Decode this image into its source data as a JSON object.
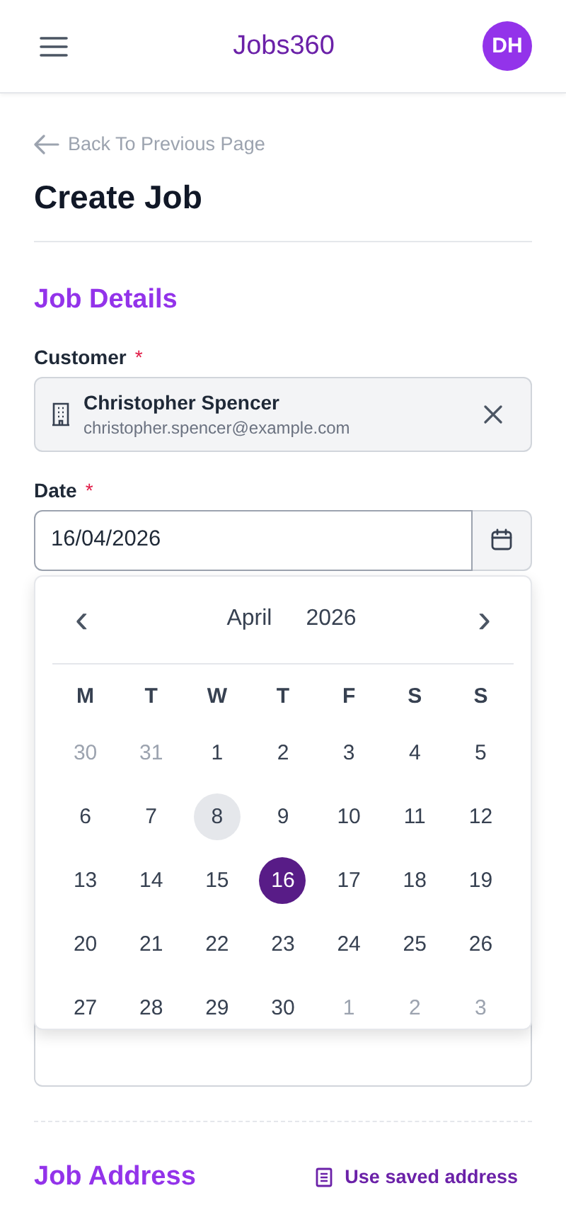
{
  "header": {
    "brand": "Jobs360",
    "avatar": "DH"
  },
  "back_link": "Back To Previous Page",
  "page_title": "Create Job",
  "job_details": {
    "heading": "Job Details",
    "customer": {
      "label": "Customer",
      "required": "*",
      "name": "Christopher Spencer",
      "email": "christopher.spencer@example.com"
    },
    "date": {
      "label": "Date",
      "required": "*",
      "value": "16/04/2026"
    }
  },
  "calendar": {
    "prev": "‹",
    "next": "›",
    "month": "April",
    "year": "2026",
    "weekdays": [
      "M",
      "T",
      "W",
      "T",
      "F",
      "S",
      "S"
    ],
    "weeks": [
      [
        {
          "day": "30",
          "outside": true,
          "selected": false,
          "today": false
        },
        {
          "day": "31",
          "outside": true,
          "selected": false,
          "today": false
        },
        {
          "day": "1",
          "outside": false,
          "selected": false,
          "today": false
        },
        {
          "day": "2",
          "outside": false,
          "selected": false,
          "today": false
        },
        {
          "day": "3",
          "outside": false,
          "selected": false,
          "today": false
        },
        {
          "day": "4",
          "outside": false,
          "selected": false,
          "today": false
        },
        {
          "day": "5",
          "outside": false,
          "selected": false,
          "today": false
        }
      ],
      [
        {
          "day": "6",
          "outside": false,
          "selected": false,
          "today": false
        },
        {
          "day": "7",
          "outside": false,
          "selected": false,
          "today": false
        },
        {
          "day": "8",
          "outside": false,
          "selected": false,
          "today": true
        },
        {
          "day": "9",
          "outside": false,
          "selected": false,
          "today": false
        },
        {
          "day": "10",
          "outside": false,
          "selected": false,
          "today": false
        },
        {
          "day": "11",
          "outside": false,
          "selected": false,
          "today": false
        },
        {
          "day": "12",
          "outside": false,
          "selected": false,
          "today": false
        }
      ],
      [
        {
          "day": "13",
          "outside": false,
          "selected": false,
          "today": false
        },
        {
          "day": "14",
          "outside": false,
          "selected": false,
          "today": false
        },
        {
          "day": "15",
          "outside": false,
          "selected": false,
          "today": false
        },
        {
          "day": "16",
          "outside": false,
          "selected": true,
          "today": false
        },
        {
          "day": "17",
          "outside": false,
          "selected": false,
          "today": false
        },
        {
          "day": "18",
          "outside": false,
          "selected": false,
          "today": false
        },
        {
          "day": "19",
          "outside": false,
          "selected": false,
          "today": false
        }
      ],
      [
        {
          "day": "20",
          "outside": false,
          "selected": false,
          "today": false
        },
        {
          "day": "21",
          "outside": false,
          "selected": false,
          "today": false
        },
        {
          "day": "22",
          "outside": false,
          "selected": false,
          "today": false
        },
        {
          "day": "23",
          "outside": false,
          "selected": false,
          "today": false
        },
        {
          "day": "24",
          "outside": false,
          "selected": false,
          "today": false
        },
        {
          "day": "25",
          "outside": false,
          "selected": false,
          "today": false
        },
        {
          "day": "26",
          "outside": false,
          "selected": false,
          "today": false
        }
      ],
      [
        {
          "day": "27",
          "outside": false,
          "selected": false,
          "today": false
        },
        {
          "day": "28",
          "outside": false,
          "selected": false,
          "today": false
        },
        {
          "day": "29",
          "outside": false,
          "selected": false,
          "today": false
        },
        {
          "day": "30",
          "outside": false,
          "selected": false,
          "today": false
        },
        {
          "day": "1",
          "outside": true,
          "selected": false,
          "today": false
        },
        {
          "day": "2",
          "outside": true,
          "selected": false,
          "today": false
        },
        {
          "day": "3",
          "outside": true,
          "selected": false,
          "today": false
        }
      ]
    ]
  },
  "job_address": {
    "heading": "Job Address",
    "saved_address_button": "Use saved address"
  }
}
